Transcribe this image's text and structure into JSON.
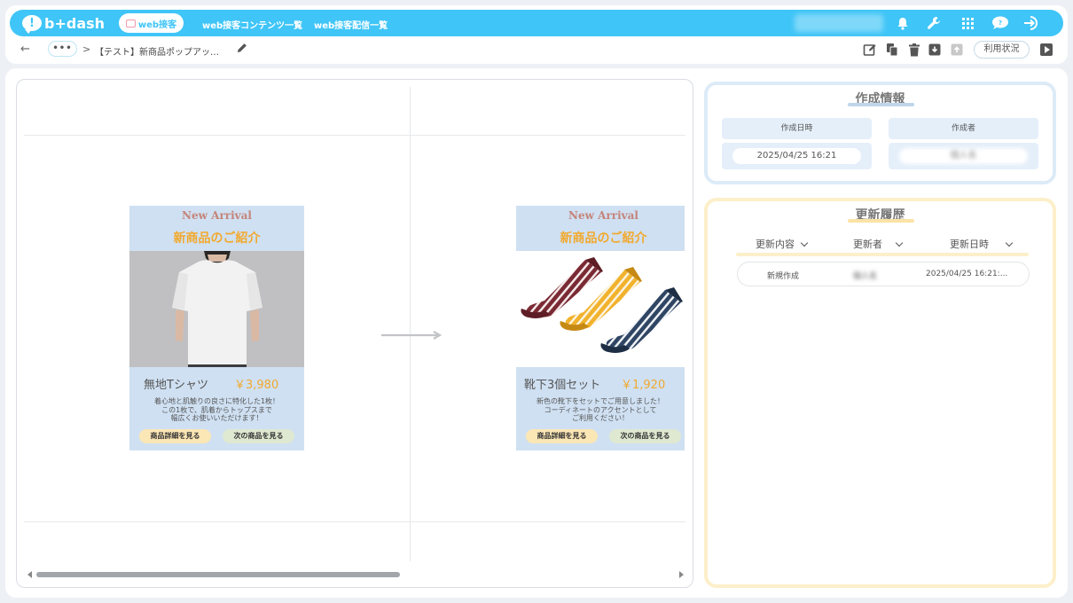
{
  "header": {
    "logo_mark": "!",
    "logo_text": "b+dash",
    "active_nav": "web接客",
    "nav_links": [
      "web接客コンテンツ一覧",
      "web接客配信一覧"
    ]
  },
  "breadcrumb": {
    "dots": "•••",
    "separator": ">",
    "title": "【テスト】新商品ポップアッ…",
    "usage_button": "利用状況"
  },
  "preview": {
    "cards": [
      {
        "tag": "New Arrival",
        "heading": "新商品のご紹介",
        "product_name": "無地Tシャツ",
        "price": "￥3,980",
        "description": "着心地と肌触りの良さに特化した1枚！\nこの1枚で、肌着からトップスまで\n幅広くお使いいただけます！",
        "detail_button": "商品詳細を見る",
        "next_button": "次の商品を見る"
      },
      {
        "tag": "New Arrival",
        "heading": "新商品のご紹介",
        "product_name": "靴下3個セット",
        "price": "￥1,920",
        "description": "新色の靴下をセットでご用意しました！\nコーディネートのアクセントとして\nご利用ください！",
        "detail_button": "商品詳細を見る",
        "next_button": "次の商品を見る"
      }
    ]
  },
  "info": {
    "title": "作成情報",
    "created_at_label": "作成日時",
    "created_at_value": "2025/04/25 16:21",
    "creator_label": "作成者",
    "creator_value": "個人名"
  },
  "history": {
    "title": "更新履歴",
    "columns": [
      "更新内容",
      "更新者",
      "更新日時"
    ],
    "rows": [
      {
        "content": "新規作成",
        "user": "個人名",
        "datetime": "2025/04/25 16:21:..."
      }
    ]
  },
  "colors": {
    "header_bg": "#3fc5f7",
    "accent_orange": "#f2a92e",
    "info_border": "#dcebf7",
    "history_border": "#fcefc9"
  }
}
